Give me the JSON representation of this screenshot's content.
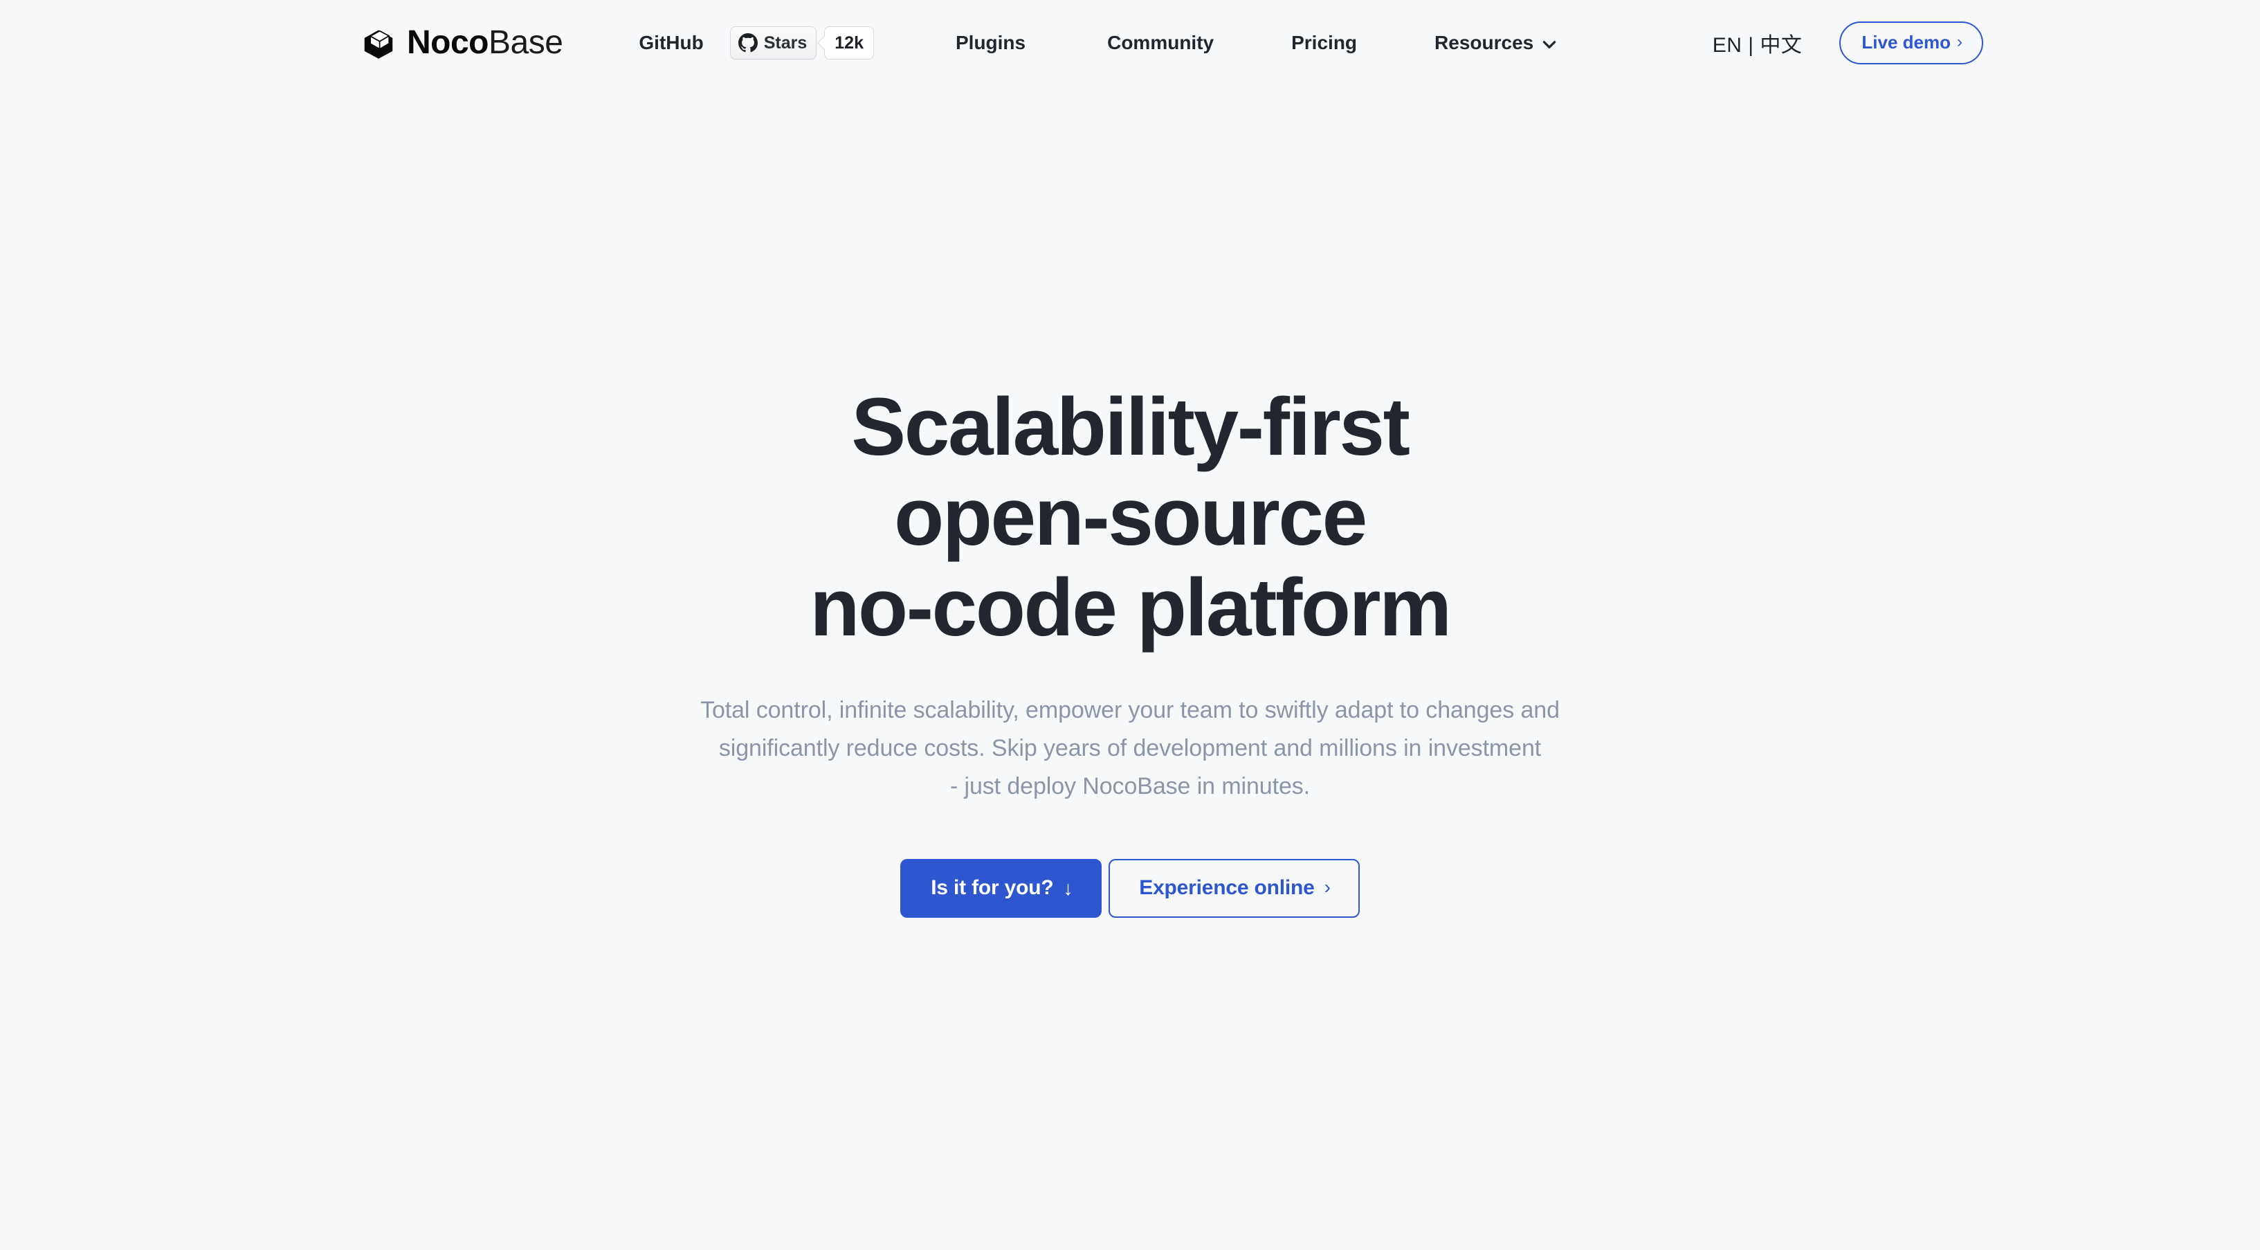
{
  "brand": {
    "name_bold": "Noco",
    "name_thin": "Base",
    "logo_icon": "nocobase-cube-logo"
  },
  "header": {
    "github": {
      "label": "GitHub",
      "stars_label": "Stars",
      "stars_count": "12k",
      "icon": "github-octocat-icon"
    },
    "nav": [
      {
        "label": "Plugins",
        "has_dropdown": false
      },
      {
        "label": "Community",
        "has_dropdown": false
      },
      {
        "label": "Pricing",
        "has_dropdown": false
      },
      {
        "label": "Resources",
        "has_dropdown": true,
        "dropdown_icon": "chevron-down-icon"
      }
    ],
    "language": "EN | 中文",
    "live_demo": {
      "label": "Live demo",
      "icon": "chevron-right-icon"
    }
  },
  "hero": {
    "title_lines": [
      "Scalability-first",
      "open-source",
      "no-code platform"
    ],
    "subtitle_lines": [
      "Total control, infinite scalability, empower your team to swiftly adapt to changes and",
      "significantly reduce costs. Skip years of development and millions in investment",
      "- just deploy NocoBase in minutes."
    ],
    "primary_cta": {
      "label": "Is it for you?",
      "icon": "arrow-down-icon",
      "glyph": "↓"
    },
    "secondary_cta": {
      "label": "Experience online",
      "icon": "chevron-right-icon",
      "glyph": "›"
    }
  },
  "colors": {
    "page_background": "#f7f8fa",
    "accent_blue": "#2d56cf",
    "heading": "#22262e",
    "muted_text": "#8b95a7",
    "nav_text": "#21262e"
  }
}
